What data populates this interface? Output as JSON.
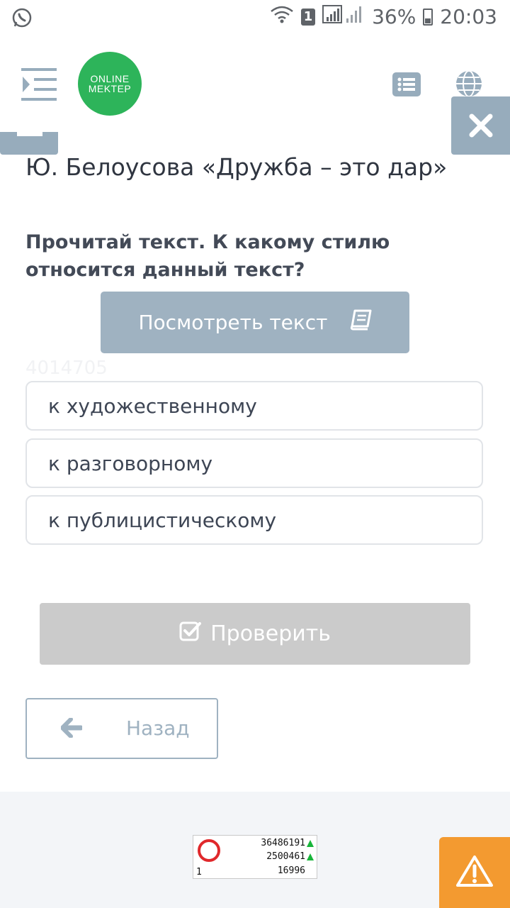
{
  "status_bar": {
    "sim_slot": "1",
    "battery": "36%",
    "time": "20:03"
  },
  "header": {
    "logo_line1": "ONLINE",
    "logo_line2": "MEKTEP",
    "icons": [
      "menu-icon",
      "list-icon",
      "globe-icon",
      "close-icon"
    ]
  },
  "lesson": {
    "title": "Ю. Белоусова «Дружба – это дар»",
    "question": "Прочитай текст. К какому стилю относится данный текст?",
    "view_text_label": "Посмотреть текст",
    "watermark": "4014705"
  },
  "options": [
    {
      "label": "к художественному"
    },
    {
      "label": "к разговорному"
    },
    {
      "label": "к публицистическому"
    }
  ],
  "actions": {
    "check_label": "Проверить",
    "back_label": "Назад"
  },
  "counter": {
    "value1": "36486191",
    "value2": "2500461",
    "value3": "16996",
    "corner": "1"
  },
  "colors": {
    "logo_green": "#2db45a",
    "button_gray_blue": "#9fb2c1",
    "warning_orange": "#f39a30",
    "disabled_gray": "#cbcbcb"
  }
}
